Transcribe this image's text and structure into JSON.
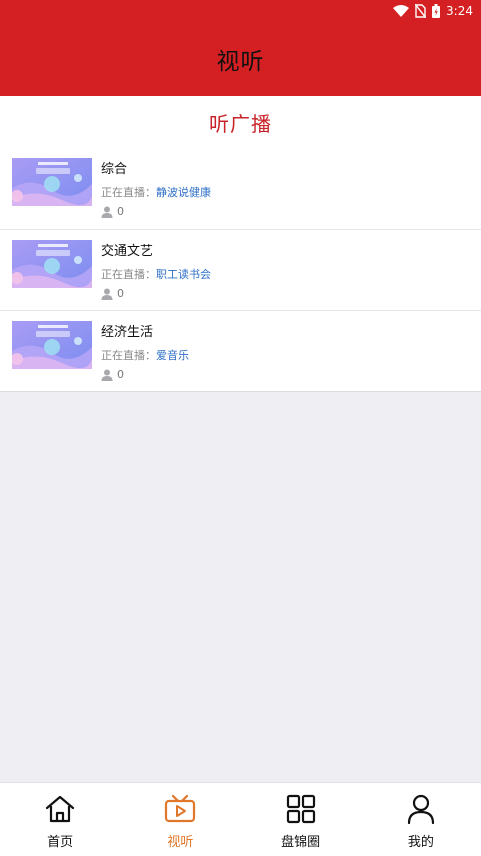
{
  "status": {
    "time": "3:24"
  },
  "appbar": {
    "title": "视听"
  },
  "section": {
    "title": "听广播"
  },
  "radio": {
    "live_label": "正在直播：",
    "items": [
      {
        "title": "综合",
        "now_playing": "静波说健康",
        "listeners": "0"
      },
      {
        "title": "交通文艺",
        "now_playing": "职工读书会",
        "listeners": "0"
      },
      {
        "title": "经济生活",
        "now_playing": "爱音乐",
        "listeners": "0"
      }
    ]
  },
  "tabs": [
    {
      "label": "首页",
      "icon": "home-icon",
      "active": false
    },
    {
      "label": "视听",
      "icon": "tv-play-icon",
      "active": true
    },
    {
      "label": "盘锦圈",
      "icon": "grid-icon",
      "active": false
    },
    {
      "label": "我的",
      "icon": "person-icon",
      "active": false
    }
  ],
  "colors": {
    "brand_red": "#d52023",
    "title_red": "#c8242a",
    "active_tab": "#e0772b",
    "link_blue": "#2f6fc7"
  }
}
